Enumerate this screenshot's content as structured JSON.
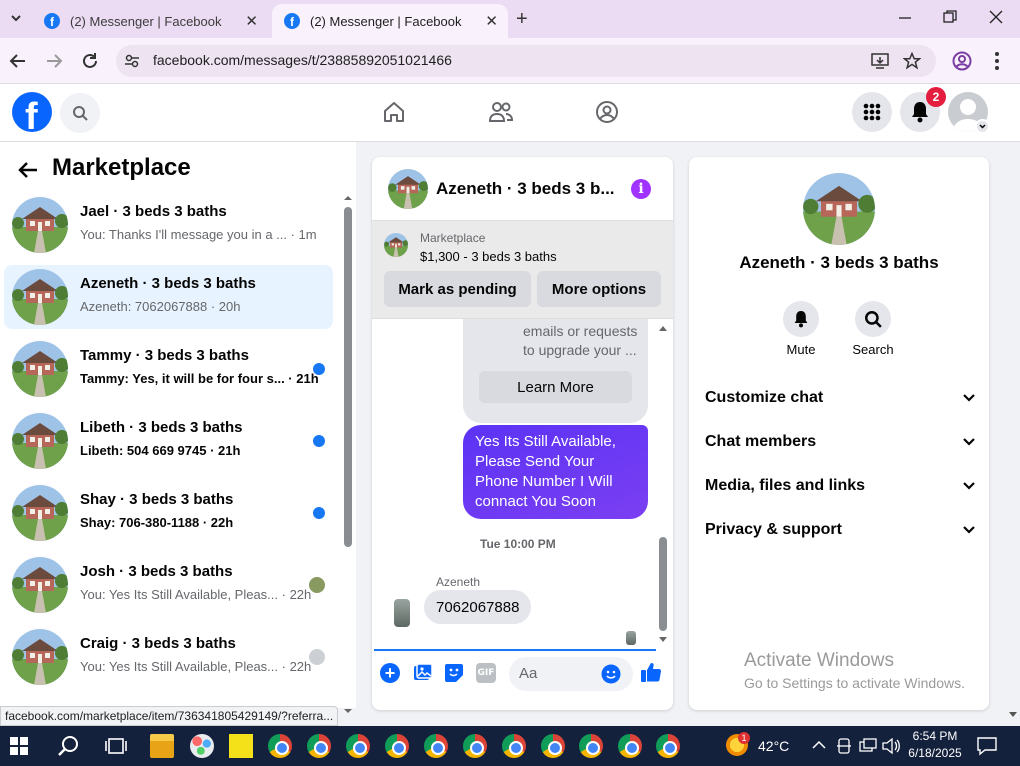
{
  "browser": {
    "tabs": [
      {
        "title": "(2) Messenger | Facebook",
        "active": false
      },
      {
        "title": "(2) Messenger | Facebook",
        "active": true
      }
    ],
    "url": "facebook.com/messages/t/23885892051021466",
    "status_url": "facebook.com/marketplace/item/736341805429149/?referra..."
  },
  "fb_header": {
    "notification_count": "2"
  },
  "left_panel": {
    "title": "Marketplace",
    "conversations": [
      {
        "name": "Jael · 3 beds 3 baths",
        "preview": "You: Thanks I'll message you in a ... · 1m",
        "unread": false,
        "selected": false
      },
      {
        "name": "Azeneth · 3 beds 3 baths",
        "preview": "Azeneth: 7062067888 · 20h",
        "unread": false,
        "selected": true
      },
      {
        "name": "Tammy · 3 beds 3 baths",
        "preview": "Tammy: Yes, it will be for four s... · 21h",
        "unread": true,
        "selected": false
      },
      {
        "name": "Libeth · 3 beds 3 baths",
        "preview": "Libeth: 504 669 9745 · 21h",
        "unread": true,
        "selected": false
      },
      {
        "name": "Shay · 3 beds 3 baths",
        "preview": "Shay: 706-380-1188 · 22h",
        "unread": true,
        "selected": false
      },
      {
        "name": "Josh · 3 beds 3 baths",
        "preview": "You: Yes Its Still Available, Pleas... · 22h",
        "unread": false,
        "selected": false
      },
      {
        "name": "Craig · 3 beds 3 baths",
        "preview": "You: Yes Its Still Available, Pleas... · 22h",
        "unread": false,
        "selected": false
      }
    ]
  },
  "chat": {
    "title": "Azeneth · 3 beds 3 b...",
    "listing_label": "Marketplace",
    "listing_price": "$1,300 - 3 beds 3 baths",
    "mark_pending": "Mark as pending",
    "more_options": "More options",
    "incoming_text_line1": "emails or requests",
    "incoming_text_line2": "to upgrade your ...",
    "learn_more": "Learn More",
    "outgoing_message": "Yes Its Still Available, Please Send Your Phone Number I Will connact You Soon",
    "timestamp": "Tue 10:00 PM",
    "sender_name": "Azeneth",
    "incoming_phone": "7062067888",
    "composer_placeholder": "Aa"
  },
  "right_panel": {
    "name": "Azeneth · 3 beds 3 baths",
    "mute_label": "Mute",
    "search_label": "Search",
    "rows": [
      "Customize chat",
      "Chat members",
      "Media, files and links",
      "Privacy & support"
    ]
  },
  "watermark": {
    "line1": "Activate Windows",
    "line2": "Go to Settings to activate Windows."
  },
  "taskbar": {
    "temperature": "42°C",
    "weather_badge": "1",
    "time": "6:54 PM",
    "date": "6/18/2025"
  }
}
